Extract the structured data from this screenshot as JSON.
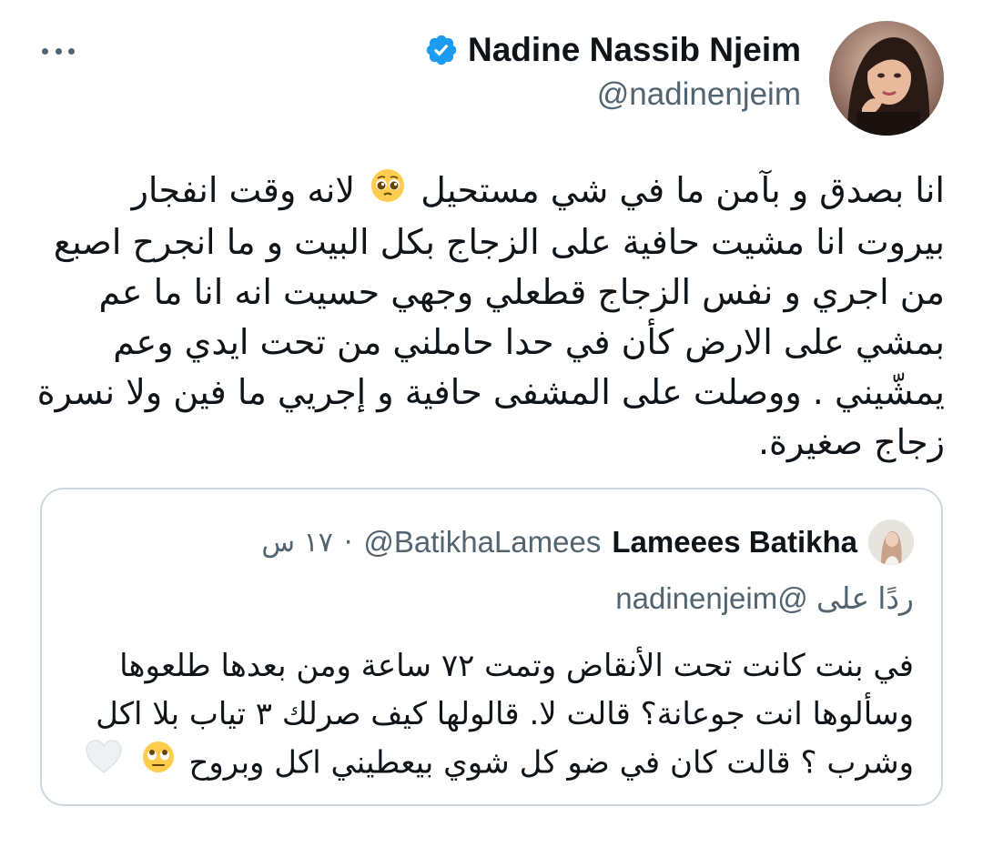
{
  "author": {
    "name": "Nadine Nassib Njeim",
    "handle": "@nadinenjeim",
    "verified": true,
    "avatar_icon": "profile-photo"
  },
  "menu": {
    "icon": "more-horizontal-icon"
  },
  "tweet": {
    "text_part1": "انا بصدق و بآمن ما في شي مستحيل",
    "emoji1": "pleading-face-icon",
    "text_part2": "لانه وقت انفجار بيروت انا مشيت حافية على الزجاج بكل البيت و ما انجرح اصبع من اجري و نفس الزجاج قطعلي وجهي حسيت انه انا ما عم بمشي على الارض كأن في حدا حاملني من تحت ايدي وعم يمشّيني . ووصلت على المشفى حافية و إجريي ما فين ولا نسرة زجاج  صغيرة."
  },
  "quoted_tweet": {
    "name": "Lameees Batikha",
    "handle": "@BatikhaLamees",
    "separator": "·",
    "time": "١٧ س",
    "reply_prefix": "ردًا على",
    "reply_mention": "@nadinenjeim",
    "text": "في بنت كانت تحت الأنقاض وتمت ٧٢ ساعة ومن بعدها طلعوها وسألوها انت جوعانة؟ قالت لا. قالولها كيف صرلك ٣ تياب بلا اكل وشرب ؟ قالت كان في ضو كل شوي بيعطيني اكل وبروح",
    "emoji_eyeroll": "face-with-rolling-eyes-icon",
    "emoji_heart": "white-heart-icon"
  },
  "colors": {
    "text_primary": "#0f1419",
    "text_secondary": "#536471",
    "verified_blue": "#1d9bf0",
    "border": "#cfd9de"
  }
}
